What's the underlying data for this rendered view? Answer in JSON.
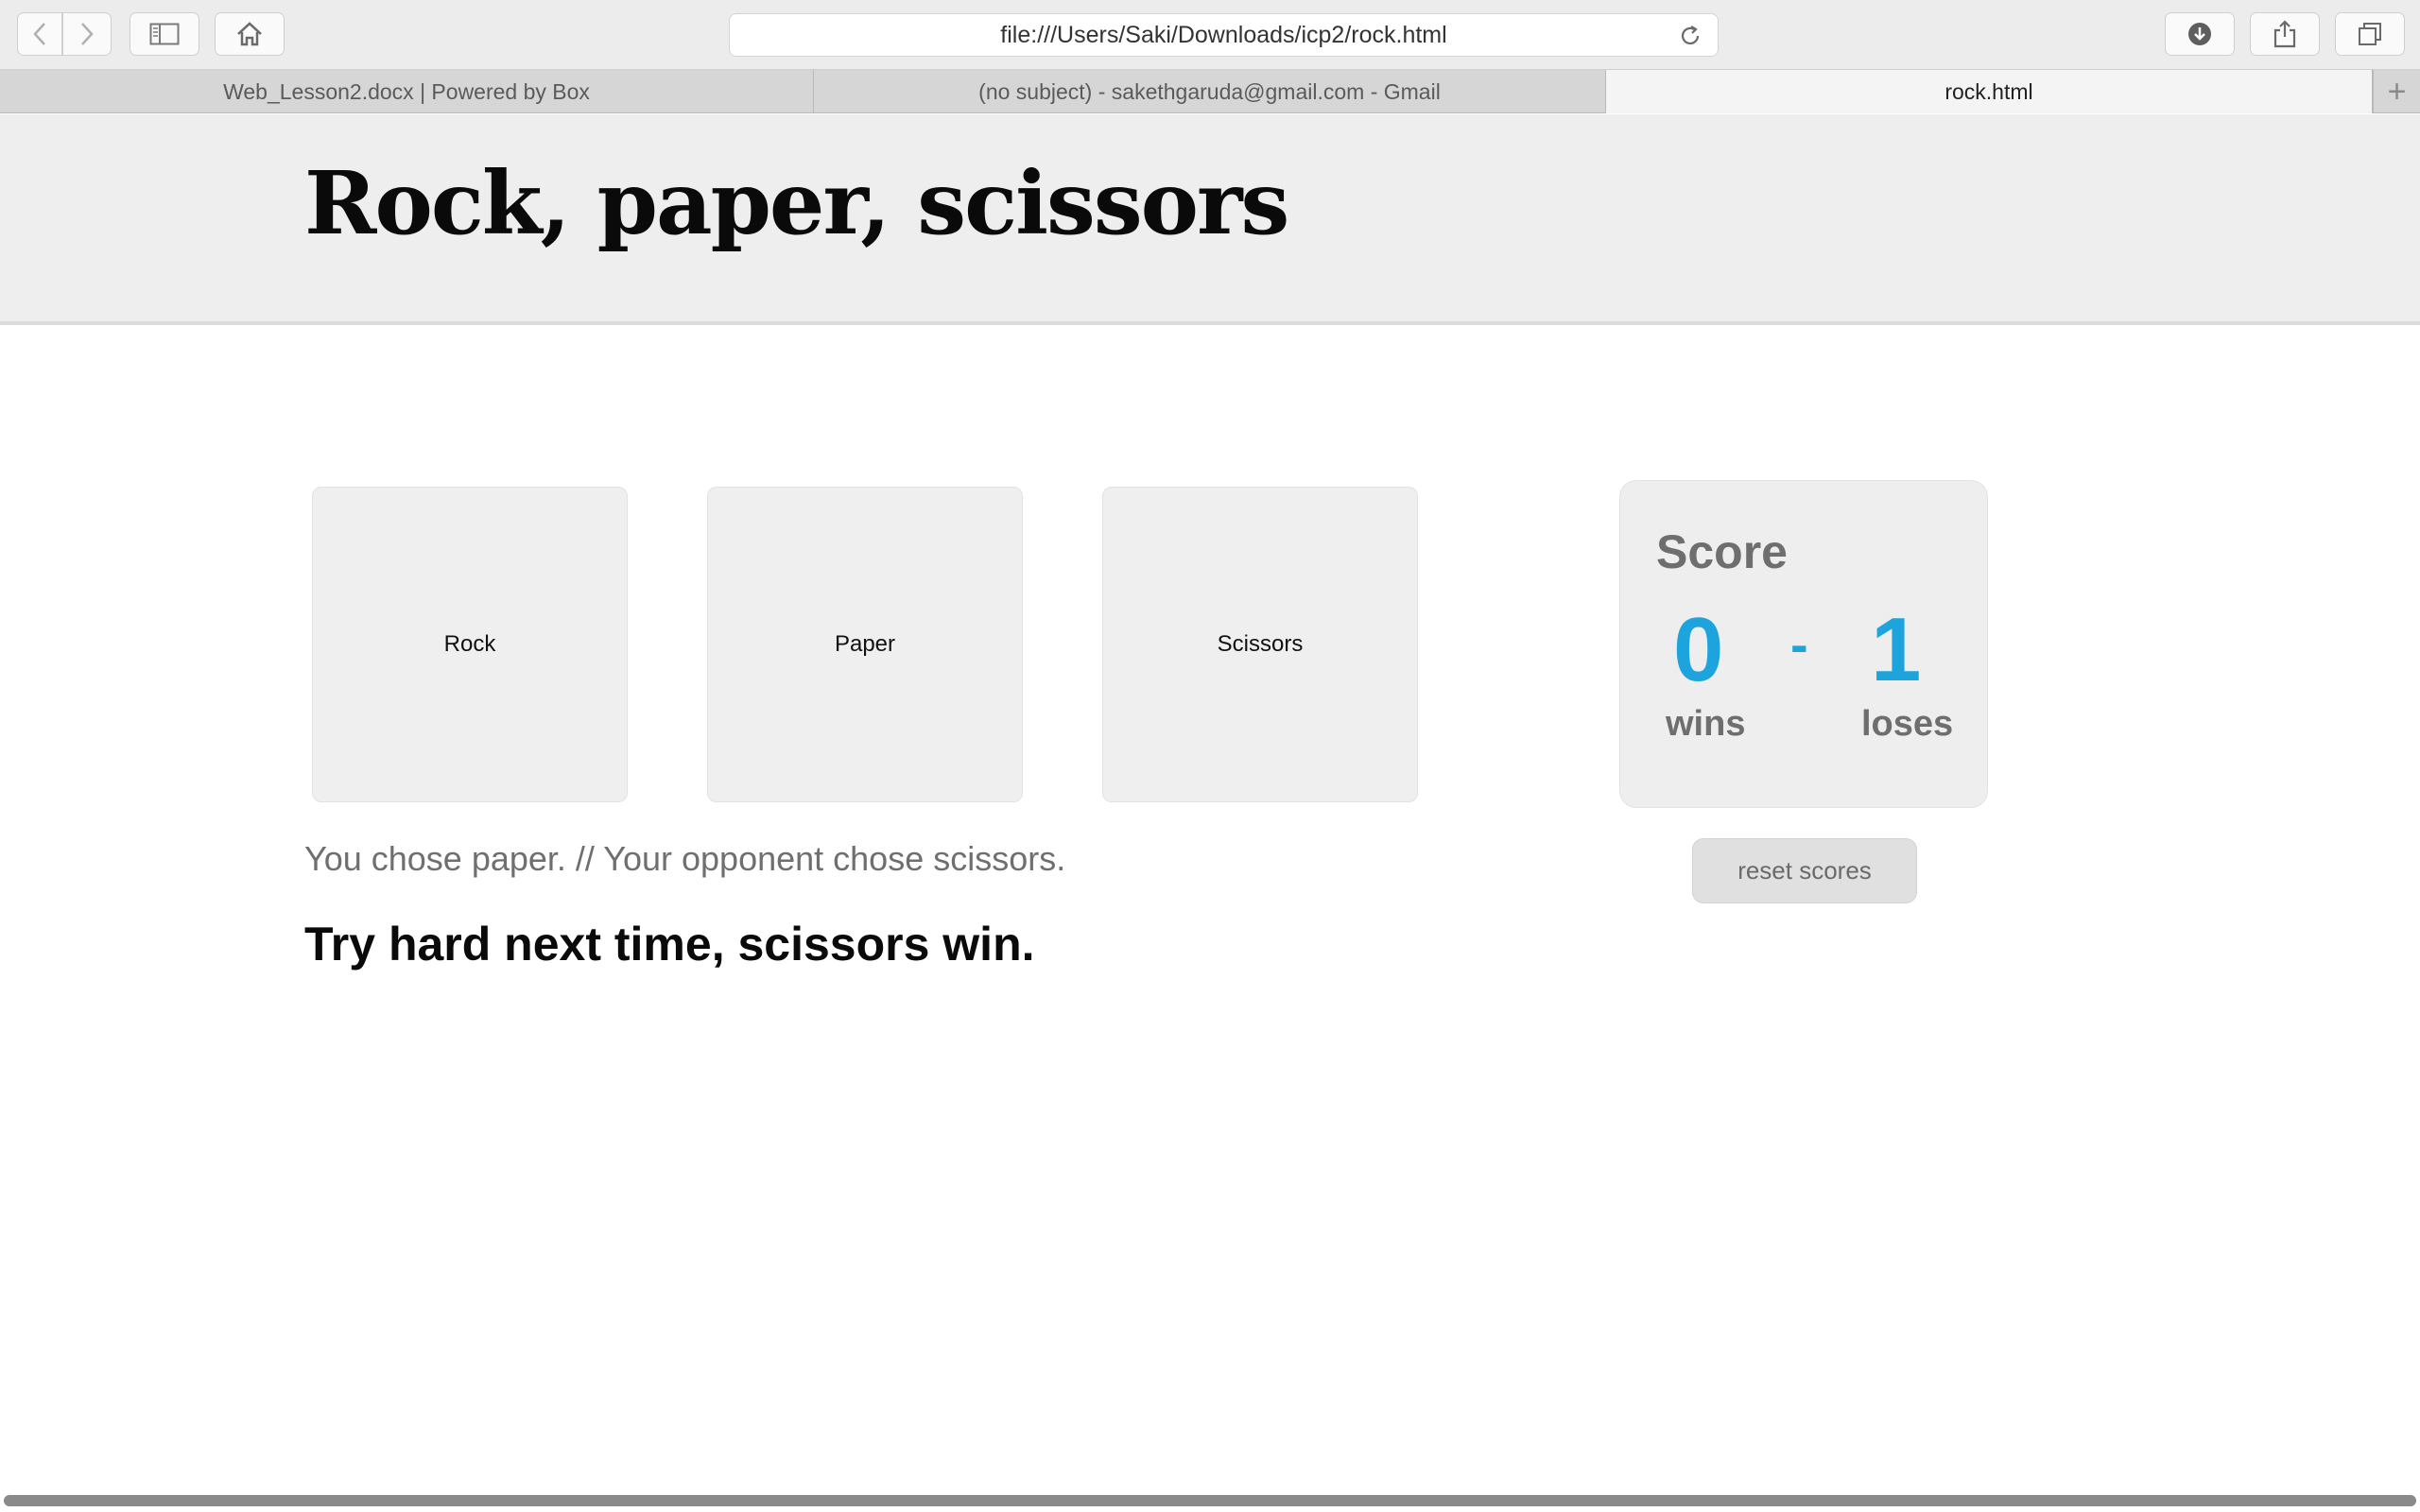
{
  "browser": {
    "url": "file:///Users/Saki/Downloads/icp2/rock.html",
    "tabs": [
      {
        "label": "Web_Lesson2.docx | Powered by Box",
        "active": false
      },
      {
        "label": "(no subject) - sakethgaruda@gmail.com - Gmail",
        "active": false
      },
      {
        "label": "rock.html",
        "active": true
      }
    ],
    "new_tab_label": "+",
    "icons": [
      "back-icon",
      "forward-icon",
      "sidebar-icon",
      "home-icon",
      "reload-icon",
      "download-icon",
      "share-icon",
      "tabs-overview-icon"
    ]
  },
  "page": {
    "title": "Rock, paper, scissors",
    "choices": [
      "Rock",
      "Paper",
      "Scissors"
    ],
    "message": "You chose paper. // Your opponent chose scissors.",
    "result": "Try hard next time, scissors win.",
    "score": {
      "title": "Score",
      "wins": "0",
      "separator": "-",
      "loses": "1",
      "wins_label": "wins",
      "loses_label": "loses"
    },
    "reset_label": "reset scores"
  },
  "colors": {
    "accent": "#1ea4dc",
    "muted_text": "#6e6e6e",
    "panel_bg": "#eeeeee"
  }
}
